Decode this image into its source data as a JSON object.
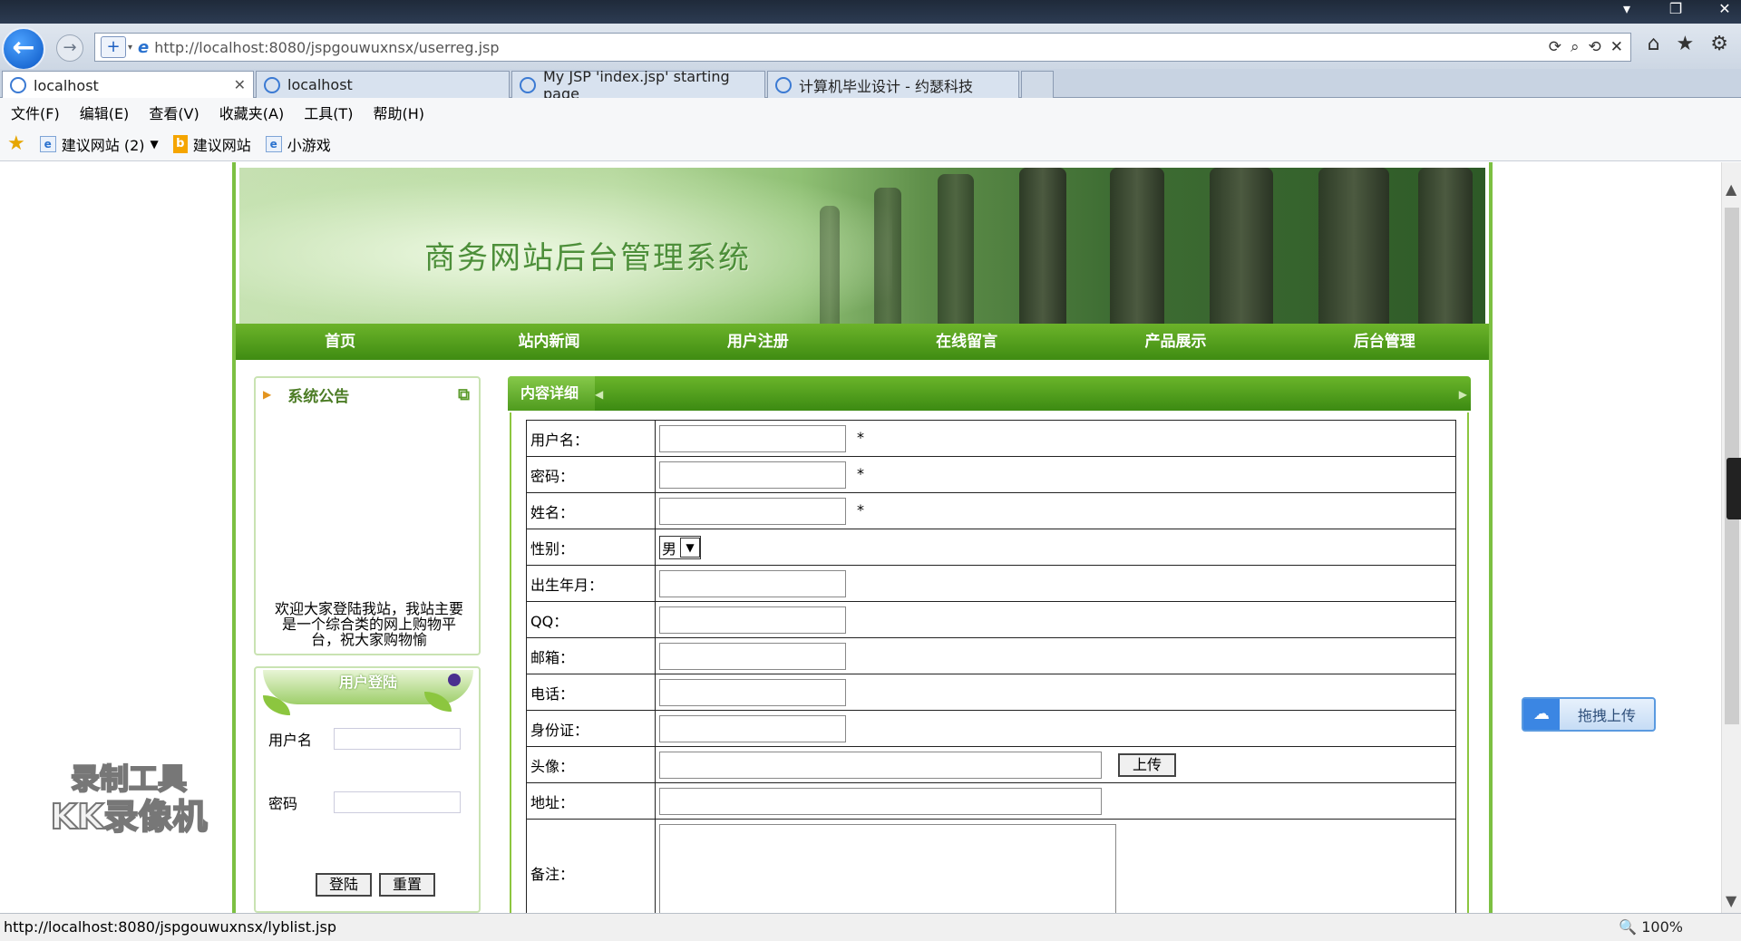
{
  "browser": {
    "window_controls": {
      "minimize": "▾",
      "restore": "❐",
      "close": "✕"
    },
    "url": "http://localhost:8080/jspgouwuxnsx/userreg.jsp",
    "tabs": [
      {
        "label": "localhost",
        "active": true
      },
      {
        "label": "localhost"
      },
      {
        "label": "My JSP 'index.jsp' starting page"
      },
      {
        "label": "计算机毕业设计 - 约瑟科技"
      }
    ],
    "menu": [
      "文件(F)",
      "编辑(E)",
      "查看(V)",
      "收藏夹(A)",
      "工具(T)",
      "帮助(H)"
    ],
    "favorites": {
      "suggested_sites": "建议网站 (2)",
      "bing_sites": "建议网站",
      "games": "小游戏"
    },
    "status_url": "http://localhost:8080/jspgouwuxnsx/lyblist.jsp",
    "zoom": "100%"
  },
  "site": {
    "banner_title": "商务网站后台管理系统",
    "nav": [
      "首页",
      "站内新闻",
      "用户注册",
      "在线留言",
      "产品展示",
      "后台管理"
    ],
    "notice": {
      "title": "系统公告",
      "body": "欢迎大家登陆我站，我站主要是一个综合类的网上购物平台，祝大家购物愉"
    },
    "login": {
      "title": "用户登陆",
      "username_label": "用户名",
      "password_label": "密码",
      "login_button": "登陆",
      "reset_button": "重置"
    },
    "content": {
      "title": "内容详细",
      "fields": {
        "username": "用户名：",
        "password": "密码：",
        "name": "姓名：",
        "gender": "性别：",
        "birth": "出生年月：",
        "qq": "QQ：",
        "email": "邮箱：",
        "phone": "电话：",
        "idcard": "身份证：",
        "avatar": "头像：",
        "address": "地址：",
        "remark": "备注："
      },
      "required_mark": "*",
      "gender_selected": "男",
      "upload_button": "上传"
    }
  },
  "overlay": {
    "cloud_upload": "拖拽上传",
    "watermark_line1": "录制工具",
    "watermark_line2": "KK录像机"
  }
}
